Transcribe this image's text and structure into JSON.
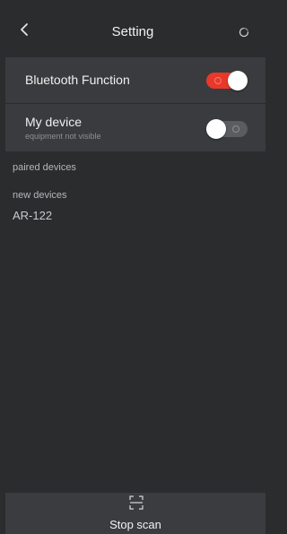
{
  "header": {
    "title": "Setting",
    "back_icon": "chevron-left-icon",
    "refresh_icon": "refresh-icon"
  },
  "settings": {
    "bluetooth": {
      "label": "Bluetooth Function",
      "enabled": true
    },
    "my_device": {
      "label": "My device",
      "subtitle": "equipment not visible",
      "enabled": false
    }
  },
  "sections": {
    "paired": "paired devices",
    "new": "new devices"
  },
  "new_devices": [
    "AR-122"
  ],
  "footer": {
    "stop_label": "Stop scan",
    "icon": "scan-icon"
  },
  "colors": {
    "background": "#2b2c2e",
    "row_background": "#3a3b3e",
    "toggle_on": "#e8382a",
    "toggle_off": "#5b5c60"
  }
}
